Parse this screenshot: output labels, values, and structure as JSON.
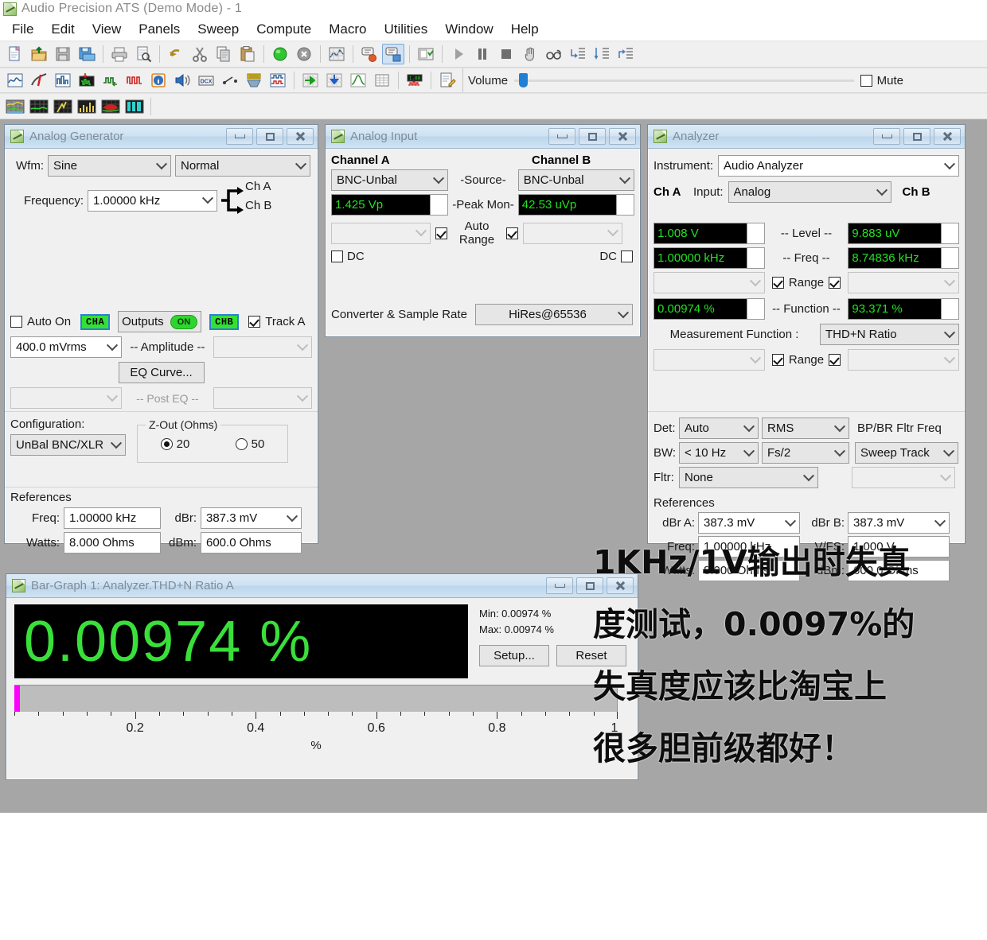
{
  "app": {
    "title": "Audio Precision ATS (Demo Mode) - 1",
    "logo_icon": "ap-leaf-icon"
  },
  "menubar": {
    "items": [
      "File",
      "Edit",
      "View",
      "Panels",
      "Sweep",
      "Compute",
      "Macro",
      "Utilities",
      "Window",
      "Help"
    ]
  },
  "toolbars": {
    "row1_icons": [
      "new-document-icon",
      "open-folder-icon",
      "save-icon",
      "save-as-icon",
      "print-icon",
      "print-preview-icon",
      "undo-icon",
      "cut-icon",
      "copy-icon",
      "paste-icon",
      "go-green-icon",
      "stop-icon",
      "graph-data-icon",
      "comment-red-icon",
      "comment-blue-icon",
      "report-icon",
      "play-icon",
      "pause-icon",
      "stop-square-icon",
      "hand-icon",
      "glasses-icon",
      "indent-right-icon",
      "indent-down-icon",
      "outdent-icon"
    ],
    "row2_icons": [
      "sweep-panel-icon",
      "generator-icon",
      "analyzer-icon",
      "digital-io-icon",
      "digital-gen-icon",
      "waveform-icon",
      "info-icon",
      "speaker-icon",
      "dcx-icon",
      "switcher-icon",
      "keyboard-icon",
      "scope-icon",
      "export-right-icon",
      "import-down-icon",
      "curve-icon",
      "table-icon",
      "meters-icon",
      "report-edit-icon"
    ],
    "row3_icons": [
      "graph-blue-icon",
      "graph-green-icon",
      "graph-spark-icon",
      "bargraph-yellow-icon",
      "graph-red-icon",
      "bars-cyan-icon"
    ],
    "volume": {
      "label": "Volume",
      "mute_label": "Mute",
      "mute_checked": false,
      "thumb_icon": "slider-thumb-icon"
    }
  },
  "analog_generator": {
    "title": "Analog Generator",
    "wfm_label": "Wfm:",
    "wfm_value": "Sine",
    "mode_value": "Normal",
    "frequency_label": "Frequency:",
    "frequency_value": "1.00000 kHz",
    "ch_a_label": "Ch A",
    "ch_b_label": "Ch B",
    "auto_on_label": "Auto On",
    "auto_on_checked": false,
    "cha_badge": "CHA",
    "chb_badge": "CHB",
    "outputs_label": "Outputs",
    "outputs_state": "ON",
    "track_a_label": "Track A",
    "track_a_checked": true,
    "amplitude_label": "-- Amplitude --",
    "amplitude_a_value": "400.0   mVrms",
    "amplitude_b_value": "",
    "eq_curve_label": "EQ Curve...",
    "post_eq_label": "-- Post EQ --",
    "post_eq_a_value": "",
    "post_eq_b_value": "",
    "configuration_label": "Configuration:",
    "configuration_value": "UnBal BNC/XLR",
    "zout_group_label": "Z-Out (Ohms)",
    "zout_option_20": "20",
    "zout_option_50": "50",
    "zout_selected": "20",
    "references_label": "References",
    "ref_freq_label": "Freq:",
    "ref_freq_value": "1.00000 kHz",
    "ref_watts_label": "Watts:",
    "ref_watts_value": "8.000    Ohms",
    "ref_dbr_label": "dBr:",
    "ref_dbr_value": "387.3   mV",
    "ref_dbm_label": "dBm:",
    "ref_dbm_value": "600.0   Ohms"
  },
  "analog_input": {
    "title": "Analog Input",
    "channel_a_label": "Channel A",
    "channel_b_label": "Channel B",
    "source_label": "-Source-",
    "source_a_value": "BNC-Unbal",
    "source_b_value": "BNC-Unbal",
    "peak_mon_label": "-Peak Mon-",
    "peak_mon_a_value": "1.425   Vp",
    "peak_mon_b_value": "42.53   uVp",
    "auto_range_label_1": "Auto",
    "auto_range_label_2": "Range",
    "auto_range_a_checked": true,
    "auto_range_b_checked": true,
    "range_a_value": "",
    "range_b_value": "",
    "dc_a_label": "DC",
    "dc_a_checked": false,
    "dc_b_label": "DC",
    "dc_b_checked": false,
    "converter_label": "Converter & Sample Rate",
    "converter_value": "HiRes@65536"
  },
  "analyzer": {
    "title": "Analyzer",
    "instrument_label": "Instrument:",
    "instrument_value": "Audio Analyzer",
    "ch_a_label": "Ch A",
    "ch_b_label": "Ch B",
    "input_label": "Input:",
    "input_value": "Analog",
    "level_label": "-- Level --",
    "level_a_value": "1.008   V",
    "level_b_value": "9.883   uV",
    "freq_label": "-- Freq --",
    "freq_a_value": "1.00000 kHz",
    "freq_b_value": "8.74836 kHz",
    "range_label": "Range",
    "range_a_checked": true,
    "range_b_checked": true,
    "range_a_value": "",
    "range_b_value": "",
    "function_label": "-- Function --",
    "function_a_value": "0.00974  %",
    "function_b_value": "93.371   %",
    "measurement_function_label": "Measurement Function :",
    "measurement_function_value": "THD+N Ratio",
    "range2_label": "Range",
    "range2_a_checked": true,
    "range2_b_checked": true,
    "det_label": "Det:",
    "det_value": "Auto",
    "det_type_value": "RMS",
    "bw_label": "BW:",
    "bw_low_value": "< 10 Hz",
    "bw_high_value": "Fs/2",
    "fltr_label": "Fltr:",
    "fltr_value": "None",
    "bpbr_label": "BP/BR Fltr Freq",
    "bpbr_value": "Sweep Track",
    "bpbr_extra_value": "",
    "references_label": "References",
    "dbr_a_label": "dBr A:",
    "dbr_a_value": "387.3   mV",
    "dbr_b_label": "dBr B:",
    "dbr_b_value": "387.3   mV",
    "freq_ref_label": "Freq:",
    "freq_ref_value": "1.00000 kHz",
    "vfs_label": "V/FS:",
    "vfs_value": "1.000    V",
    "watts_label": "Watts:",
    "watts_value": "8.000   Ohms",
    "dbm_label": "dBm:",
    "dbm_value": "600.0  Ohms"
  },
  "bargraph": {
    "title": "Bar-Graph 1: Analyzer.THD+N Ratio A",
    "value": "0.00974   %",
    "min_label": "Min: 0.00974  %",
    "max_label": "Max: 0.00974  %",
    "setup_label": "Setup...",
    "reset_label": "Reset",
    "bar_color": "#ff00ff",
    "unit": "%"
  },
  "chart_data": {
    "type": "bar",
    "title": "Bar-Graph 1: Analyzer.THD+N Ratio A",
    "orientation": "horizontal",
    "categories": [
      "THD+N Ratio A"
    ],
    "values": [
      0.00974
    ],
    "value_text": "0.00974   %",
    "xlabel": "%",
    "ylabel": "",
    "xlim": [
      0,
      1
    ],
    "xticks": [
      0.2,
      0.4,
      0.6,
      0.8,
      1
    ],
    "xtick_labels": [
      "0.2",
      "0.4",
      "0.6",
      "0.8",
      "1"
    ],
    "minor_ticks_per_major": 5,
    "grid": false,
    "legend": false,
    "series_color": "#ff00ff",
    "plot_bg": "#bdbdbd",
    "annotations": [
      "Min: 0.00974  %",
      "Max: 0.00974  %"
    ]
  },
  "annotation": {
    "lines": [
      "1KHz/1V输出时失真",
      "度测试，0.0097%的",
      "失真度应该比淘宝上",
      "很多胆前级都好！"
    ]
  }
}
